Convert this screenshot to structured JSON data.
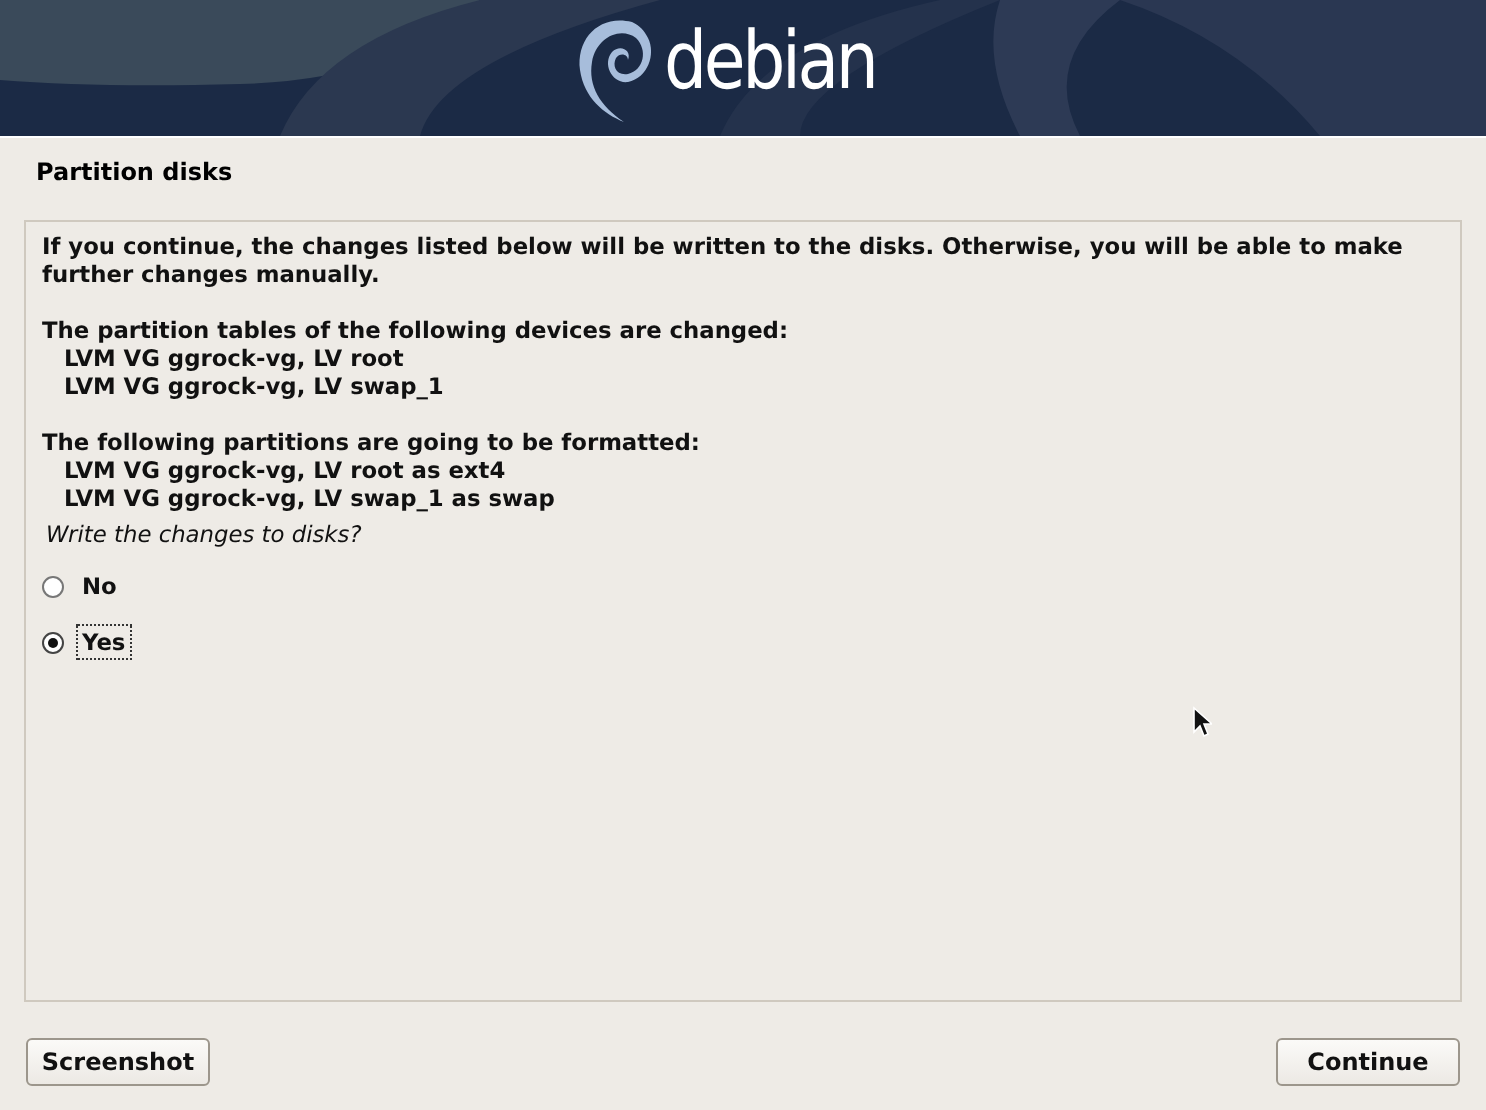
{
  "header": {
    "logo_text": "debian"
  },
  "title": "Partition disks",
  "intro": "If you continue, the changes listed below will be written to the disks. Otherwise, you will be able to make further changes manually.",
  "sections": [
    {
      "heading": "The partition tables of the following devices are changed:",
      "items": [
        "LVM VG ggrock-vg, LV root",
        "LVM VG ggrock-vg, LV swap_1"
      ]
    },
    {
      "heading": "The following partitions are going to be formatted:",
      "items": [
        "LVM VG ggrock-vg, LV root as ext4",
        "LVM VG ggrock-vg, LV swap_1 as swap"
      ]
    }
  ],
  "question": "Write the changes to disks?",
  "options": [
    {
      "label": "No",
      "selected": false
    },
    {
      "label": "Yes",
      "selected": true
    }
  ],
  "buttons": [
    {
      "label": "Screenshot"
    },
    {
      "label": "Continue"
    }
  ]
}
